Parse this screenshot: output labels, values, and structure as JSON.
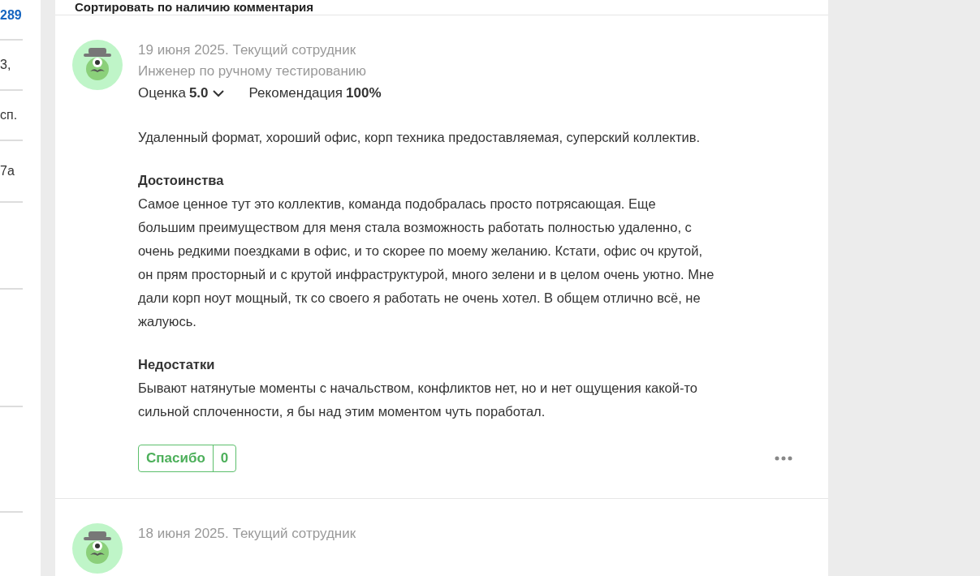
{
  "sidebar": {
    "items": [
      {
        "text": "289",
        "kind": "link"
      },
      {
        "text": "3,",
        "kind": "text"
      },
      {
        "text": "сп.",
        "kind": "text"
      },
      {
        "text": "7а",
        "kind": "text"
      }
    ]
  },
  "sort": {
    "label": "Сортировать по наличию комментария"
  },
  "reviews": [
    {
      "date": "19 июня 2025. Текущий сотрудник",
      "position": "Инженер по ручному тестированию",
      "rating_label": "Оценка",
      "rating": "5.0",
      "recommend_label": "Рекомендация",
      "recommend": "100%",
      "summary": "Удаленный формат, хороший офис, корп техника предоставляемая, суперский коллектив.",
      "sections": [
        {
          "title": "Достоинства",
          "text": "Самое ценное тут это коллектив, команда подобралась просто потрясающая. Еще большим преимуществом для меня стала возможность работать полностью удаленно, с очень редкими поездками в офис, и то скорее по моему желанию. Кстати, офис оч крутой, он прям просторный и с крутой инфраструктурой, много зелени и в целом очень уютно. Мне дали корп ноут мощный, тк со своего я работать не очень хотел. В общем отлично всё, не жалуюсь."
        },
        {
          "title": "Недостатки",
          "text": "Бывают натянутые моменты с начальством, конфликтов нет, но и нет ощущения какой-то сильной сплоченности, я бы над этим моментом чуть поработал."
        }
      ],
      "thanks_label": "Спасибо",
      "thanks_count": "0"
    },
    {
      "date": "18 июня 2025. Текущий сотрудник"
    }
  ]
}
